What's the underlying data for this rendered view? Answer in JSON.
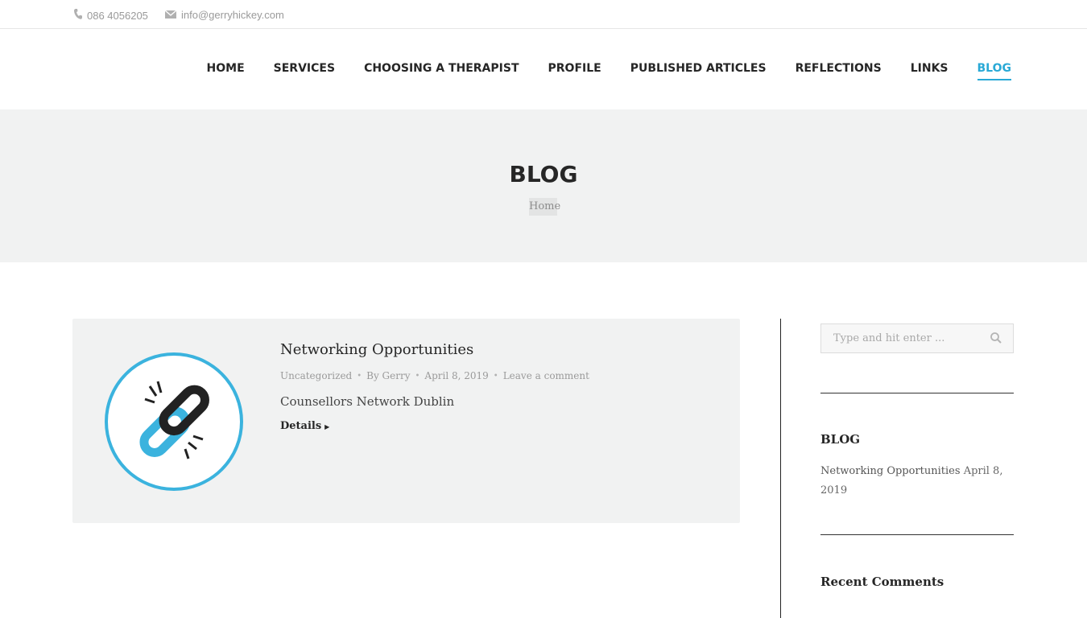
{
  "topbar": {
    "phone": "086 4056205",
    "email": "info@gerryhickey.com",
    "phone_icon": "phone-icon",
    "email_icon": "mail-icon"
  },
  "nav": {
    "items": [
      {
        "label": "HOME"
      },
      {
        "label": "SERVICES"
      },
      {
        "label": "CHOOSING A THERAPIST"
      },
      {
        "label": "PROFILE"
      },
      {
        "label": "PUBLISHED ARTICLES"
      },
      {
        "label": "REFLECTIONS"
      },
      {
        "label": "LINKS"
      },
      {
        "label": "BLOG"
      }
    ],
    "active": "BLOG",
    "accent_color": "#29a9d6"
  },
  "page": {
    "title": "BLOG",
    "breadcrumb": "Home"
  },
  "post": {
    "title": "Networking Opportunities",
    "category": "Uncategorized",
    "author": "By Gerry",
    "date": "April 8, 2019",
    "comments": "Leave a comment",
    "excerpt": "Counsellors Network Dublin",
    "details_label": "Details",
    "thumbnail_icon": "broken-link-icon"
  },
  "sidebar": {
    "search_placeholder": "Type and hit enter ...",
    "blog_title": "BLOG",
    "recent_post_title": "Networking Opportunities",
    "recent_post_date": "April 8, 2019",
    "comments_title": "Recent Comments"
  }
}
